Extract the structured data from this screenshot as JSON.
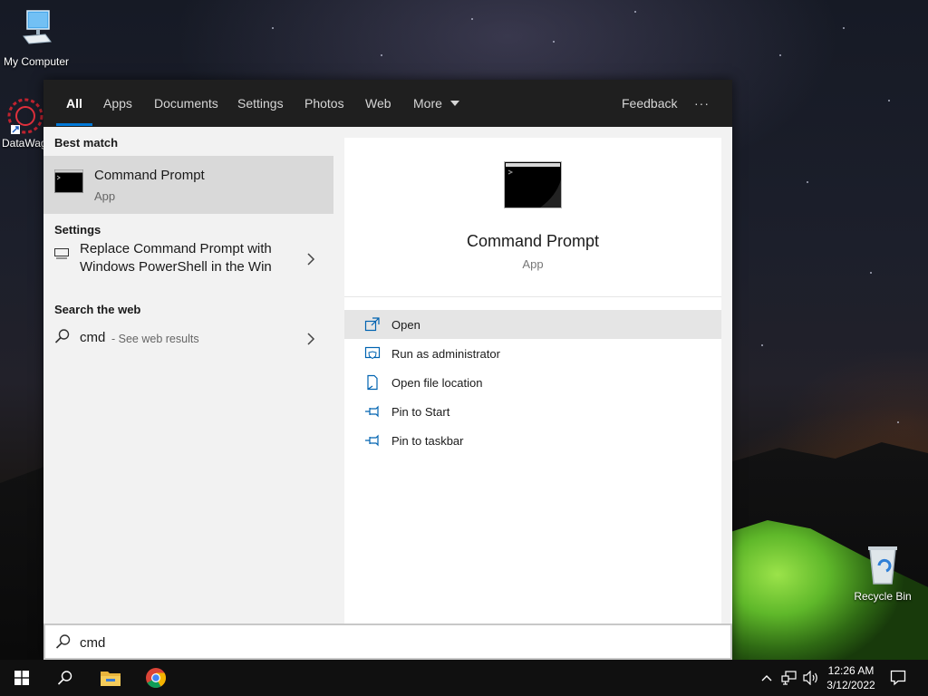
{
  "desktop": {
    "icons": [
      {
        "label": "My Computer"
      },
      {
        "label": "DataWag"
      },
      {
        "label": "Recycle Bin"
      }
    ]
  },
  "search": {
    "tabs": [
      "All",
      "Apps",
      "Documents",
      "Settings",
      "Photos",
      "Web",
      "More"
    ],
    "feedback_label": "Feedback",
    "more_options": "···",
    "query": "cmd",
    "accent_color": "#0078d7"
  },
  "results": {
    "best_match_title": "Best match",
    "best_match": {
      "name": "Command Prompt",
      "type": "App"
    },
    "settings_title": "Settings",
    "settings_item_line1": "Replace Command Prompt with",
    "settings_item_line2": "Windows PowerShell in the Win",
    "web_title": "Search the web",
    "web_query": "cmd",
    "web_suffix": "- See web results"
  },
  "detail": {
    "name": "Command Prompt",
    "type": "App",
    "actions": [
      "Open",
      "Run as administrator",
      "Open file location",
      "Pin to Start",
      "Pin to taskbar"
    ]
  },
  "taskbar": {
    "time": "12:26 AM",
    "date": "3/12/2022"
  }
}
